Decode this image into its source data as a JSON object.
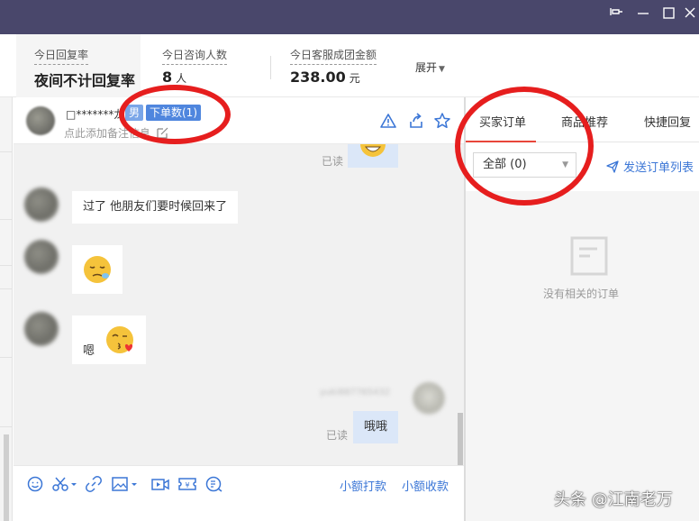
{
  "stats": {
    "reply_rate_label": "今日回复率",
    "reply_rate_value": "夜间不计回复率",
    "inquiries_label": "今日咨询人数",
    "inquiries_value": "8",
    "inquiries_unit": "人",
    "amount_label": "今日客服成团金额",
    "amount_value": "238.00",
    "amount_unit": "元",
    "expand_label": "展开"
  },
  "chat": {
    "username": "□*******龙",
    "gender_tag": "男",
    "orders_tag": "下单数(1)",
    "note_placeholder": "点此添加备注信息",
    "messages": {
      "read_1": "已读",
      "text_1": "过了   他朋友们要时候回来了",
      "text_2": "嗯",
      "blurred_name": "yuki887765432",
      "read_2": "已读",
      "self_text": "哦哦"
    },
    "toolbar": {
      "small_pay": "小额打款",
      "small_collect": "小额收款"
    }
  },
  "right": {
    "tabs": [
      "买家订单",
      "商品推荐",
      "快捷回复"
    ],
    "active_tab": 0,
    "filter_value": "全部 (0)",
    "send_list": "发送订单列表",
    "empty_text": "没有相关的订单"
  },
  "watermark": "头条 @江南老万",
  "colors": {
    "titlebar": "#49476b",
    "link": "#3b76d6",
    "annotation": "#e61e1e",
    "active_tab_underline": "#e8463a"
  }
}
